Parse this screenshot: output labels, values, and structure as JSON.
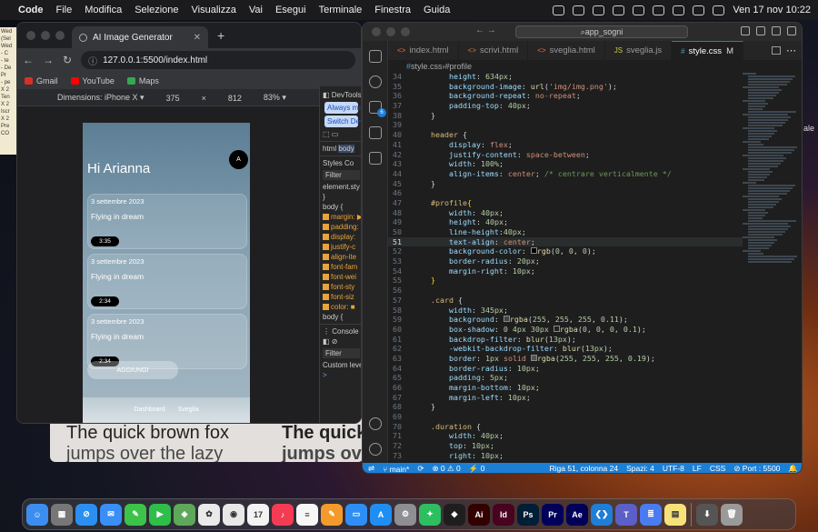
{
  "menubar": {
    "apple": "",
    "items": [
      "Code",
      "File",
      "Modifica",
      "Selezione",
      "Visualizza",
      "Vai",
      "Esegui",
      "Terminale",
      "Finestra",
      "Guida"
    ],
    "clock": "Ven 17 nov  10:22"
  },
  "desktop": {
    "note_lines": [
      "Wed",
      "(Sel",
      "Wed",
      "- C",
      "- te",
      "- De",
      "Pr",
      "- pe",
      "X 2",
      "Ten",
      "X 2",
      "Iscr",
      "X 2",
      "Pre",
      "CO"
    ],
    "right_text": "ale",
    "preview_texts": [
      "The quick brown fox",
      "jumps over the lazy",
      "The quick",
      "jumps ove"
    ]
  },
  "chrome": {
    "tab_title": "AI Image Generator",
    "url": "127.0.0.1:5500/index.html",
    "bookmarks": [
      {
        "label": "Gmail",
        "color": "#d93025"
      },
      {
        "label": "YouTube",
        "color": "#ff0000"
      },
      {
        "label": "Maps",
        "color": "#34a853"
      }
    ],
    "device_toolbar": {
      "dimensions": "Dimensions: iPhone X ▾",
      "width": "375",
      "x": "×",
      "height": "812",
      "zoom": "83% ▾"
    }
  },
  "app": {
    "greeting": "Hi Arianna",
    "avatar": "A",
    "cards": [
      {
        "date": "3 settembre 2023",
        "title": "Flying in dream",
        "duration": "3:35"
      },
      {
        "date": "3 settembre 2023",
        "title": "Flying in dream",
        "duration": "2:34"
      },
      {
        "date": "3 settembre 2023",
        "title": "Flying in dream",
        "duration": "2:34"
      }
    ],
    "add_button": "AGGIUNGI",
    "nav": [
      "Dashboard",
      "Sveglia"
    ]
  },
  "devtools": {
    "title": "DevTools",
    "always_btn": "Always matc",
    "switch_btn": "Switch DevT",
    "crumbs": [
      "html",
      "body"
    ],
    "styles_tabs": [
      "Styles",
      "Co"
    ],
    "filter": "Filter",
    "element_style": "element.sty",
    "brace_close": "}",
    "body_rule": "body {",
    "props": [
      "margin: ▶",
      "padding:",
      "display:",
      "justify-c",
      "align-ite",
      "font-fam",
      "font-wei",
      "font-sty",
      "font-siz",
      "color: ■"
    ],
    "body_tail": "body {",
    "console_tab": "Console",
    "console_filter": "Filter",
    "custom_levels": "Custom level",
    "prompt": ">"
  },
  "vscode": {
    "search": "app_sogni",
    "tabs": [
      {
        "icon": "<>",
        "label": "index.html",
        "active": false,
        "modified": false
      },
      {
        "icon": "<>",
        "label": "scrivi.html",
        "active": false,
        "modified": false
      },
      {
        "icon": "<>",
        "label": "sveglia.html",
        "active": false,
        "modified": false
      },
      {
        "icon": "JS",
        "label": "sveglia.js",
        "active": false,
        "modified": false
      },
      {
        "icon": "#",
        "label": "style.css",
        "active": true,
        "modified": true,
        "mod_mark": "M"
      }
    ],
    "breadcrumb": [
      "style.css",
      "#profile"
    ],
    "activity_badge": "6",
    "status": {
      "branch": "main*",
      "errors": "⊗ 0 ⚠ 0",
      "ports": "⚡ 0",
      "position": "Riga 51, colonna 24",
      "spaces": "Spazi: 4",
      "encoding": "UTF-8",
      "eol": "LF",
      "lang": "CSS",
      "port": "⊘ Port : 5500"
    }
  },
  "code": [
    {
      "n": "34",
      "t": "        <span class='prop'>height</span>: <span class='num2'>634px</span>;"
    },
    {
      "n": "35",
      "t": "        <span class='prop'>background-image</span>: <span class='fn'>url</span>(<span class='str'>'img/img.png'</span>);"
    },
    {
      "n": "36",
      "t": "        <span class='prop'>background-repeat</span>: <span class='val'>no-repeat</span>;"
    },
    {
      "n": "37",
      "t": "        <span class='prop'>padding-top</span>: <span class='num2'>40px</span>;"
    },
    {
      "n": "38",
      "t": "    }"
    },
    {
      "n": "39",
      "t": ""
    },
    {
      "n": "40",
      "t": "    <span class='sel'>header</span> {"
    },
    {
      "n": "41",
      "t": "        <span class='prop'>display</span>: <span class='val'>flex</span>;"
    },
    {
      "n": "42",
      "t": "        <span class='prop'>justify-content</span>: <span class='val'>space-between</span>;"
    },
    {
      "n": "43",
      "t": "        <span class='prop'>width</span>: <span class='num2'>100%</span>;"
    },
    {
      "n": "44",
      "t": "        <span class='prop'>align-items</span>: <span class='val'>center</span>; <span class='com'>/* centrare verticalmente */</span>"
    },
    {
      "n": "45",
      "t": "    }"
    },
    {
      "n": "46",
      "t": ""
    },
    {
      "n": "47",
      "t": "    <span class='sel'>#profile</span><span class='br'>{</span>"
    },
    {
      "n": "48",
      "t": "        <span class='prop'>width</span>: <span class='num2'>40px</span>;"
    },
    {
      "n": "49",
      "t": "        <span class='prop'>height</span>: <span class='num2'>40px</span>;"
    },
    {
      "n": "50",
      "t": "        <span class='prop'>line-height</span>:<span class='num2'>40px</span>;"
    },
    {
      "n": "51",
      "t": "        <span class='prop'>text-align</span>: <span class='val'>center</span>;",
      "cur": true
    },
    {
      "n": "52",
      "t": "        <span class='prop'>background-color</span>: <span style='border:1px solid #888;display:inline-block;width:7px;height:7px;background:#000'></span><span class='fn'>rgb</span>(<span class='num2'>0</span>, <span class='num2'>0</span>, <span class='num2'>0</span>);"
    },
    {
      "n": "53",
      "t": "        <span class='prop'>border-radius</span>: <span class='num2'>20px</span>;"
    },
    {
      "n": "54",
      "t": "        <span class='prop'>margin-right</span>: <span class='num2'>10px</span>;"
    },
    {
      "n": "55",
      "t": "    <span class='br'>}</span>"
    },
    {
      "n": "56",
      "t": ""
    },
    {
      "n": "57",
      "t": "    <span class='sel'>.card</span> {"
    },
    {
      "n": "58",
      "t": "        <span class='prop'>width</span>: <span class='num2'>345px</span>;"
    },
    {
      "n": "59",
      "t": "        <span class='prop'>background</span>: <span style='border:1px solid #888;display:inline-block;width:7px;height:7px;background:#444'></span><span class='fn'>rgba</span>(<span class='num2'>255</span>, <span class='num2'>255</span>, <span class='num2'>255</span>, <span class='num2'>0.11</span>);"
    },
    {
      "n": "60",
      "t": "        <span class='prop'>box-shadow</span>: <span class='num2'>0 4px 30px</span> <span style='border:1px solid #888;display:inline-block;width:7px;height:7px;background:#222'></span><span class='fn'>rgba</span>(<span class='num2'>0</span>, <span class='num2'>0</span>, <span class='num2'>0</span>, <span class='num2'>0.1</span>);"
    },
    {
      "n": "61",
      "t": "        <span class='prop'>backdrop-filter</span>: <span class='fn'>blur</span>(<span class='num2'>13px</span>);"
    },
    {
      "n": "62",
      "t": "        <span class='prop'>-webkit-backdrop-filter</span>: <span class='fn'>blur</span>(<span class='num2'>13px</span>);"
    },
    {
      "n": "63",
      "t": "        <span class='prop'>border</span>: <span class='num2'>1px</span> <span class='val'>solid</span> <span style='border:1px solid #888;display:inline-block;width:7px;height:7px;background:#555'></span><span class='fn'>rgba</span>(<span class='num2'>255</span>, <span class='num2'>255</span>, <span class='num2'>255</span>, <span class='num2'>0.19</span>);"
    },
    {
      "n": "64",
      "t": "        <span class='prop'>border-radius</span>: <span class='num2'>10px</span>;"
    },
    {
      "n": "65",
      "t": "        <span class='prop'>padding</span>: <span class='num2'>5px</span>;"
    },
    {
      "n": "66",
      "t": "        <span class='prop'>margin-bottom</span>: <span class='num2'>10px</span>;"
    },
    {
      "n": "67",
      "t": "        <span class='prop'>margin-left</span>: <span class='num2'>10px</span>;"
    },
    {
      "n": "68",
      "t": "    }"
    },
    {
      "n": "69",
      "t": ""
    },
    {
      "n": "70",
      "t": "    <span class='sel'>.duration</span> {"
    },
    {
      "n": "71",
      "t": "        <span class='prop'>width</span>: <span class='num2'>40px</span>;"
    },
    {
      "n": "72",
      "t": "        <span class='prop'>top</span>: <span class='num2'>10px</span>;"
    },
    {
      "n": "73",
      "t": "        <span class='prop'>right</span>: <span class='num2'>10px</span>;"
    }
  ],
  "dock": [
    {
      "name": "finder-icon",
      "color": "#3b8ef0",
      "glyph": "☺"
    },
    {
      "name": "launchpad-icon",
      "color": "#777",
      "glyph": "▦"
    },
    {
      "name": "safari-icon",
      "color": "#2a8ff0",
      "glyph": "⊘"
    },
    {
      "name": "mail-icon",
      "color": "#3a8ef7",
      "glyph": "✉"
    },
    {
      "name": "messages-icon",
      "color": "#3cc34a",
      "glyph": "✎"
    },
    {
      "name": "facetime-icon",
      "color": "#2fbe4a",
      "glyph": "▶"
    },
    {
      "name": "maps-icon",
      "color": "#5ea85a",
      "glyph": "◈"
    },
    {
      "name": "photos-icon",
      "color": "#eaeaea",
      "glyph": "✿"
    },
    {
      "name": "chrome-icon",
      "color": "#e8e8e8",
      "glyph": "◉"
    },
    {
      "name": "calendar-icon",
      "color": "#f3f3f3",
      "glyph": "17"
    },
    {
      "name": "music-icon",
      "color": "#f43b54",
      "glyph": "♪"
    },
    {
      "name": "notes-icon",
      "color": "#f7f7f7",
      "glyph": "≡"
    },
    {
      "name": "pages-icon",
      "color": "#f49a2b",
      "glyph": "✎"
    },
    {
      "name": "keynote-icon",
      "color": "#2f8ef5",
      "glyph": "▭"
    },
    {
      "name": "appstore-icon",
      "color": "#1f8ef2",
      "glyph": "A"
    },
    {
      "name": "settings-icon",
      "color": "#8e8e93",
      "glyph": "⚙"
    },
    {
      "name": "evernote-icon",
      "color": "#2dbe60",
      "glyph": "✦"
    },
    {
      "name": "figma-icon",
      "color": "#1e1e1e",
      "glyph": "◆"
    },
    {
      "name": "illustrator-icon",
      "color": "#330000",
      "glyph": "Ai"
    },
    {
      "name": "indesign-icon",
      "color": "#49021f",
      "glyph": "Id"
    },
    {
      "name": "photoshop-icon",
      "color": "#001e36",
      "glyph": "Ps"
    },
    {
      "name": "premiere-icon",
      "color": "#00005b",
      "glyph": "Pr"
    },
    {
      "name": "aftereffects-icon",
      "color": "#00005b",
      "glyph": "Ae"
    },
    {
      "name": "vscode-icon",
      "color": "#1f7ed6",
      "glyph": "❮❯"
    },
    {
      "name": "teams-icon",
      "color": "#5b5fc7",
      "glyph": "T"
    },
    {
      "name": "docs-icon",
      "color": "#4a7bf0",
      "glyph": "≣"
    },
    {
      "name": "stickies-icon",
      "color": "#f7e27a",
      "glyph": "▤"
    },
    {
      "name": "downloads-icon",
      "color": "#555",
      "glyph": "⬇"
    },
    {
      "name": "trash-icon",
      "color": "#9a9a9a",
      "glyph": "🗑"
    }
  ]
}
